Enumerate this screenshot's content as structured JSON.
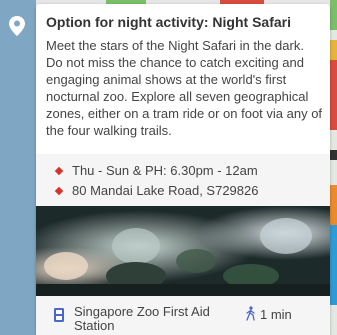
{
  "popup": {
    "title": "Option for night activity: Night Safari",
    "description": "Meet the stars of the Night Safari in the dark. Do not miss the chance to catch exciting and engaging animal shows at the world's first nocturnal zoo. Explore all seven geographical zones, either on a tram ride or on foot via any of the four walking trails.",
    "hours": "Thu - Sun & PH: 6.30pm - 12am",
    "address": "80 Mandai Lake Road, S729826",
    "nearest_stop": "Singapore Zoo First Aid Station",
    "walk_time": "1 min"
  },
  "icons": {
    "location_pin": "map-pin-icon",
    "bullet": "diamond-bullet-icon",
    "stop": "bus-stop-icon",
    "walk": "walking-person-icon"
  },
  "colors": {
    "accent": "#d6342c",
    "stop_icon": "#4a66c9",
    "map_water": "#7fa7c3"
  }
}
